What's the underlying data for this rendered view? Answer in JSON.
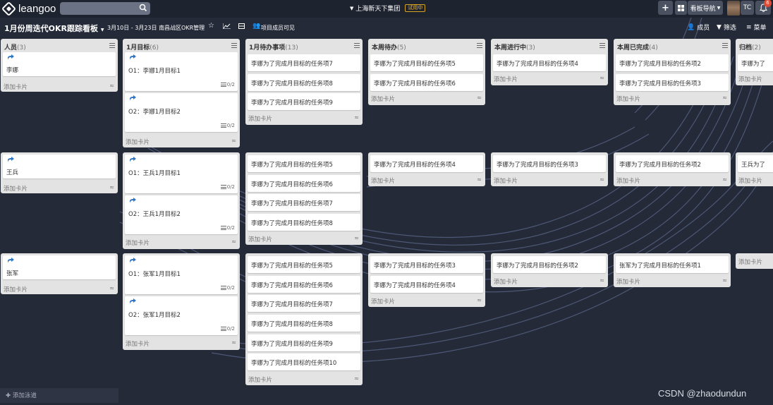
{
  "topbar": {
    "logo_text": "leangoo",
    "search_placeholder": "",
    "org_name": "上海新天下集团",
    "trial_badge": "试用中",
    "board_nav": "看板导航",
    "user_initials": "TC",
    "notification_count": "6"
  },
  "board": {
    "title": "1月份周迭代OKR跟踪看板",
    "date_range": "3月10日 - 3月23日",
    "group": "南昌战区OKR管理",
    "visibility": "项目成员可见",
    "members_label": "成员",
    "filter_label": "筛选",
    "menu_label": "菜单"
  },
  "columns": [
    {
      "title": "人员",
      "count": "(3)"
    },
    {
      "title": "1月目标",
      "count": "(6)"
    },
    {
      "title": "1月待办事项",
      "count": "(13)"
    },
    {
      "title": "本周待办",
      "count": "(5)"
    },
    {
      "title": "本周进行中",
      "count": "(3)"
    },
    {
      "title": "本周已完成",
      "count": "(4)"
    },
    {
      "title": "归档",
      "count": "(2)"
    }
  ],
  "add_card_label": "添加卡片",
  "add_swimlane_label": "添加泳道",
  "lanes": [
    {
      "person": "李娜",
      "goals": [
        {
          "text": "O1：李娜1月目标1",
          "progress": "0/2"
        },
        {
          "text": "O2：李娜1月目标2",
          "progress": "0/2"
        }
      ],
      "backlog": [
        "李娜为了完成月目标的任务项7",
        "李娜为了完成月目标的任务项8",
        "李娜为了完成月目标的任务项9"
      ],
      "todo": [
        "李娜为了完成月目标的任务项5",
        "李娜为了完成月目标的任务项6"
      ],
      "doing": [
        "李娜为了完成月目标的任务项4"
      ],
      "done": [
        "李娜为了完成月目标的任务项2",
        "李娜为了完成月目标的任务项3"
      ],
      "archive": [
        "李娜为了"
      ]
    },
    {
      "person": "王兵",
      "goals": [
        {
          "text": "O1：王兵1月目标1",
          "progress": "0/2"
        },
        {
          "text": "O2：王兵1月目标2",
          "progress": "0/2"
        }
      ],
      "backlog": [
        "李娜为了完成月目标的任务项5",
        "李娜为了完成月目标的任务项6",
        "李娜为了完成月目标的任务项7",
        "李娜为了完成月目标的任务项8"
      ],
      "todo": [
        "李娜为了完成月目标的任务项4"
      ],
      "doing": [
        "李娜为了完成月目标的任务项3"
      ],
      "done": [
        "李娜为了完成月目标的任务项2"
      ],
      "archive": [
        "王兵为了"
      ]
    },
    {
      "person": "张军",
      "goals": [
        {
          "text": "O1：张军1月目标1",
          "progress": "0/2"
        },
        {
          "text": "O2：张军1月目标2",
          "progress": "0/2"
        }
      ],
      "backlog": [
        "李娜为了完成月目标的任务项5",
        "李娜为了完成月目标的任务项6",
        "李娜为了完成月目标的任务项7",
        "李娜为了完成月目标的任务项8",
        "李娜为了完成月目标的任务项9",
        "李娜为了完成月目标的任务项10"
      ],
      "todo": [
        "李娜为了完成月目标的任务项3",
        "李娜为了完成月目标的任务项4"
      ],
      "doing": [
        "李娜为了完成月目标的任务项2"
      ],
      "done": [
        "张军为了完成月目标的任务项1"
      ],
      "archive": []
    }
  ],
  "watermark": "CSDN @zhaodundun",
  "colors": {
    "board_bg": "#242a38",
    "topbar_bg": "#1e2330",
    "list_bg": "#e3e3e3",
    "trial_badge": "#d9a41e",
    "notification": "#e04b33"
  },
  "icons": [
    "search-icon",
    "caret-down-icon",
    "star-icon",
    "chart-icon",
    "layout-icon",
    "people-icon",
    "user-icon",
    "filter-icon",
    "menu-icon",
    "plus-icon",
    "grid-icon",
    "bell-icon",
    "share-icon",
    "checklist-icon",
    "collapse-icon"
  ]
}
